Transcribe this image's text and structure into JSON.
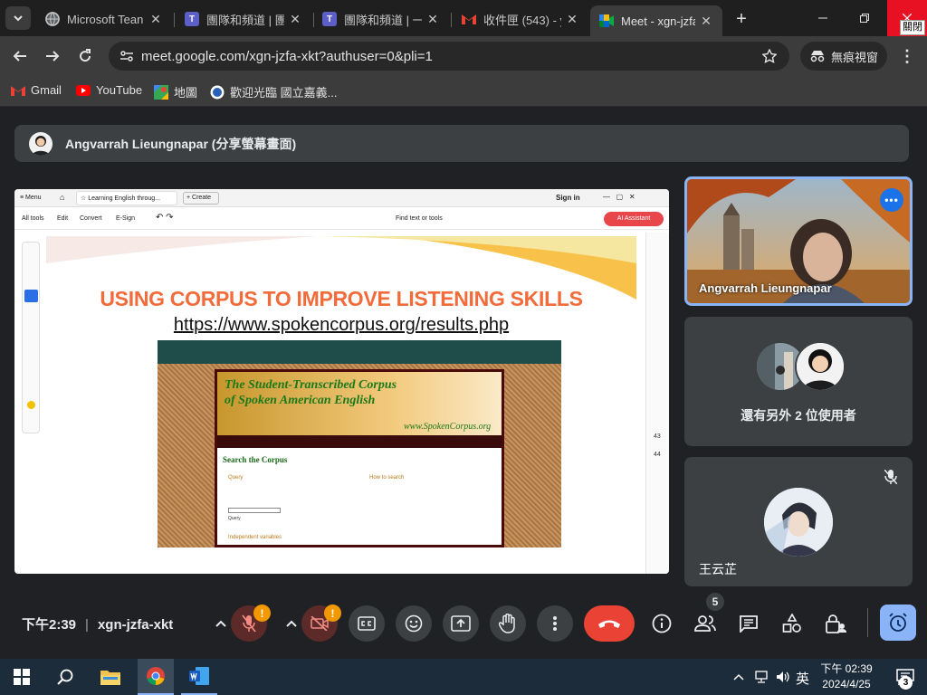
{
  "browser": {
    "tabs": [
      {
        "label": "Microsoft Tean",
        "icon": "microsoft-icon"
      },
      {
        "label": "團隊和頻道 | 團",
        "icon": "teams-icon"
      },
      {
        "label": "團隊和頻道 | 一",
        "icon": "teams-icon"
      },
      {
        "label": "收件匣 (543) - y",
        "icon": "gmail-icon"
      },
      {
        "label": "Meet - xgn-jzfa",
        "icon": "meet-icon"
      }
    ],
    "close_tooltip": "關閉",
    "url": "meet.google.com/xgn-jzfa-xkt?authuser=0&pli=1",
    "incognito_label": "無痕視窗",
    "bookmarks": [
      "Gmail",
      "YouTube",
      "地圖",
      "歡迎光臨 國立嘉義..."
    ]
  },
  "meet": {
    "presenter_banner": "Angvarrah Lieungnapar (分享螢幕畫面)",
    "participants": {
      "main_name": "Angvarrah Lieungnapar",
      "others_text": "還有另外 2 位使用者",
      "third_name": "王云芷"
    },
    "time": "下午2:39",
    "meeting_code": "xgn-jzfa-xkt",
    "people_count": "5",
    "alert_badge": "!"
  },
  "shared": {
    "menu_label": "Menu",
    "tab_title": "Learning English throug...",
    "create_label": "Create",
    "sign_in": "Sign in",
    "tools": [
      "All tools",
      "Edit",
      "Convert",
      "E-Sign"
    ],
    "find_label": "Find text or tools",
    "ai_label": "AI Assistant",
    "slide_title": "USING CORPUS TO IMPROVE LISTENING SKILLS",
    "slide_link": "https://www.spokencorpus.org/results.php",
    "corpus_title_line1": "The Student-Transcribed Corpus",
    "corpus_title_line2": "of Spoken American English",
    "corpus_url": "www.SpokenCorpus.org",
    "search_heading": "Search the Corpus",
    "query_label": "Query",
    "query_button": "Query",
    "indep_label": "Independent variables",
    "how_label": "How to search",
    "page_numbers": [
      "43",
      "44"
    ]
  },
  "taskbar": {
    "time": "下午 02:39",
    "date": "2024/4/25",
    "ime": "英",
    "notif_count": "3"
  },
  "colors": {
    "accent": "#8ab4f8",
    "end_call": "#ea4335",
    "slide_title": "#f26b3a"
  }
}
